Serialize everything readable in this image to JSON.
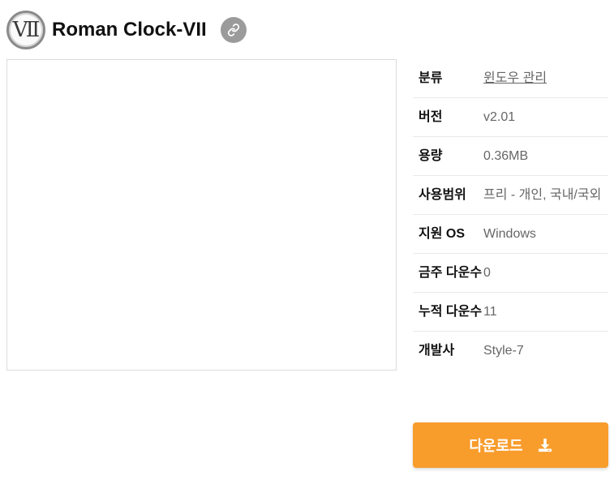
{
  "app": {
    "logo_text": "Ⅶ",
    "title": "Roman Clock-VII"
  },
  "icons": {
    "share": "link-icon",
    "download": "download-icon"
  },
  "info": [
    {
      "label": "분류",
      "value": "윈도우 관리",
      "link": true
    },
    {
      "label": "버전",
      "value": "v2.01"
    },
    {
      "label": "용량",
      "value": "0.36MB"
    },
    {
      "label": "사용범위",
      "value": "프리 - 개인, 국내/국외"
    },
    {
      "label": "지원 OS",
      "value": "Windows"
    },
    {
      "label": "금주 다운수",
      "value": "0"
    },
    {
      "label": "누적 다운수",
      "value": "11"
    },
    {
      "label": "개발사",
      "value": "Style-7"
    }
  ],
  "download": {
    "label": "다운로드"
  },
  "colors": {
    "accent": "#f89c2c",
    "share_button": "#9b9b9b"
  }
}
